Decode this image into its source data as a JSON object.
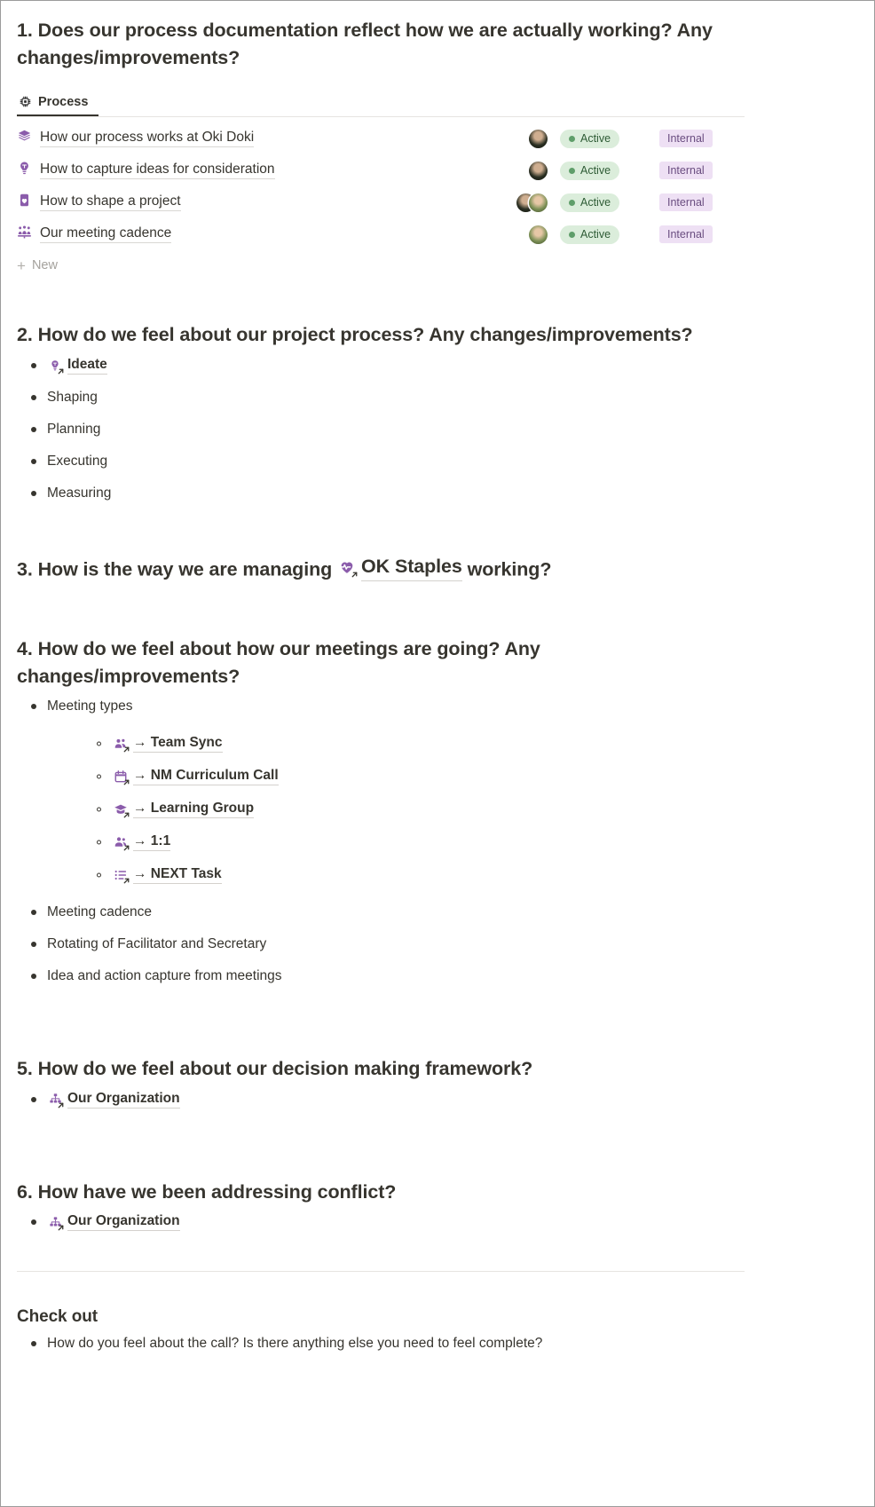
{
  "sections": {
    "q1": {
      "heading": "1. Does our process documentation reflect how we are actually working? Any changes/improvements?",
      "tab": {
        "label": "Process",
        "icon": "cpu-chip-icon"
      },
      "database": {
        "rows": [
          {
            "icon": "layers-icon",
            "title": "How our process works at Oki Doki",
            "avatars": [
              "dark"
            ],
            "status": "Active",
            "tag": "Internal"
          },
          {
            "icon": "lightbulb-icon",
            "title": "How to capture ideas for consideration",
            "avatars": [
              "dark"
            ],
            "status": "Active",
            "tag": "Internal"
          },
          {
            "icon": "heart-card-icon",
            "title": "How to shape a project",
            "avatars": [
              "dark",
              "green"
            ],
            "status": "Active",
            "tag": "Internal"
          },
          {
            "icon": "presentation-people-icon",
            "title": "Our meeting cadence",
            "avatars": [
              "green"
            ],
            "status": "Active",
            "tag": "Internal"
          }
        ],
        "new_label": "New"
      }
    },
    "q2": {
      "heading": "2. How do we feel about our project process? Any changes/improvements?",
      "items": [
        {
          "type": "link",
          "icon": "lightbulb-icon",
          "label": "Ideate"
        },
        {
          "type": "text",
          "label": "Shaping"
        },
        {
          "type": "text",
          "label": "Planning"
        },
        {
          "type": "text",
          "label": "Executing"
        },
        {
          "type": "text",
          "label": "Measuring"
        }
      ]
    },
    "q3": {
      "heading_before": "3. How is the way we are managing",
      "link": {
        "icon": "heart-pulse-icon",
        "label": "OK Staples"
      },
      "heading_after": "working?"
    },
    "q4": {
      "heading": "4. How do we feel about how our meetings are going? Any changes/improvements?",
      "meeting_types_label": "Meeting types",
      "meeting_types": [
        {
          "icon": "people-group-icon",
          "label": "→ Team Sync"
        },
        {
          "icon": "calendar-icon",
          "label": "→ NM Curriculum Call"
        },
        {
          "icon": "graduation-cap-icon",
          "label": "→ Learning Group"
        },
        {
          "icon": "two-people-icon",
          "label": "→ 1:1"
        },
        {
          "icon": "checklist-icon",
          "label": "→ NEXT Task"
        }
      ],
      "other_items": [
        "Meeting cadence",
        "Rotating of Facilitator and Secretary",
        "Idea and action capture from meetings"
      ]
    },
    "q5": {
      "heading": "5. How do we feel about our decision making framework?",
      "link": {
        "icon": "org-chart-icon",
        "label": "Our Organization"
      }
    },
    "q6": {
      "heading": "6. How have we been addressing conflict?",
      "link": {
        "icon": "org-chart-icon",
        "label": "Our Organization"
      }
    },
    "checkout": {
      "heading": "Check out",
      "items": [
        "How do you feel about the call? Is there anything else you need to feel complete?"
      ]
    }
  },
  "colors": {
    "accent_purple": "#8b5cab",
    "status_bg": "#dbeddb",
    "status_text": "#2e5b35",
    "tag_bg": "#eee0f4",
    "tag_text": "#6a4d80",
    "text": "#37352f",
    "muted": "#a5a29d"
  }
}
